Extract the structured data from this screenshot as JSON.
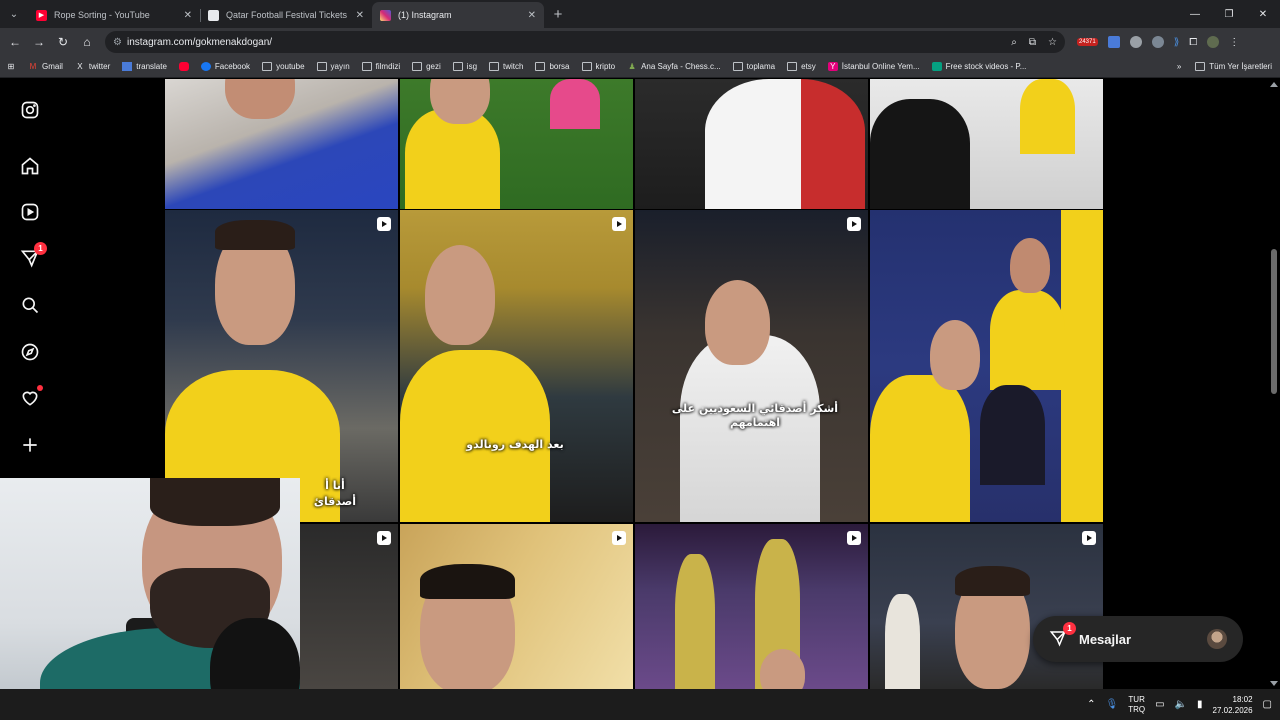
{
  "browser": {
    "tabs": [
      {
        "title": "Rope Sorting - YouTube",
        "favicon_color": "#ff0033",
        "active": false
      },
      {
        "title": "Qatar Football Festival Tickets ...",
        "favicon_color": "#e8eaed",
        "active": false
      },
      {
        "title": "(1) Instagram",
        "favicon_color": "#d6249f",
        "active": true
      }
    ],
    "url": "instagram.com/gokmenakdogan/",
    "extension_badge": "24371"
  },
  "bookmarks": {
    "items": [
      "Gmail",
      "twitter",
      "translate",
      "Facebook",
      "youtube",
      "yayın",
      "filmdizi",
      "gezi",
      "isg",
      "twitch",
      "borsa",
      "kripto",
      "Ana Sayfa - Chess.c...",
      "toplama",
      "etsy",
      "İstanbul Online Yem...",
      "Free stock videos - P..."
    ],
    "all_bookmarks": "Tüm Yer İşaretleri"
  },
  "instagram": {
    "sidebar": {
      "notifications_count": "1",
      "icons": [
        "instagram-logo-icon",
        "home-icon",
        "reels-icon",
        "messages-icon",
        "search-icon",
        "explore-icon",
        "heart-icon",
        "create-icon"
      ]
    },
    "captions": {
      "tile_friends": "أشكر أصدقائي السعوديين على اهتمامهم",
      "tile_goal": "بعد الهدف رونالدو",
      "tile_partial_1": "أنا أ",
      "tile_partial_2": "أصدقائ"
    },
    "messages": {
      "label": "Mesajlar",
      "count": "1"
    }
  },
  "taskbar": {
    "lang_top": "TUR",
    "lang_bottom": "TRQ",
    "time": "18:02",
    "date": "27.02.2026"
  },
  "colors": {
    "accent_red": "#ff3040",
    "alnassr_yellow": "#f2d01b",
    "alnassr_blue": "#1d3a8a"
  }
}
